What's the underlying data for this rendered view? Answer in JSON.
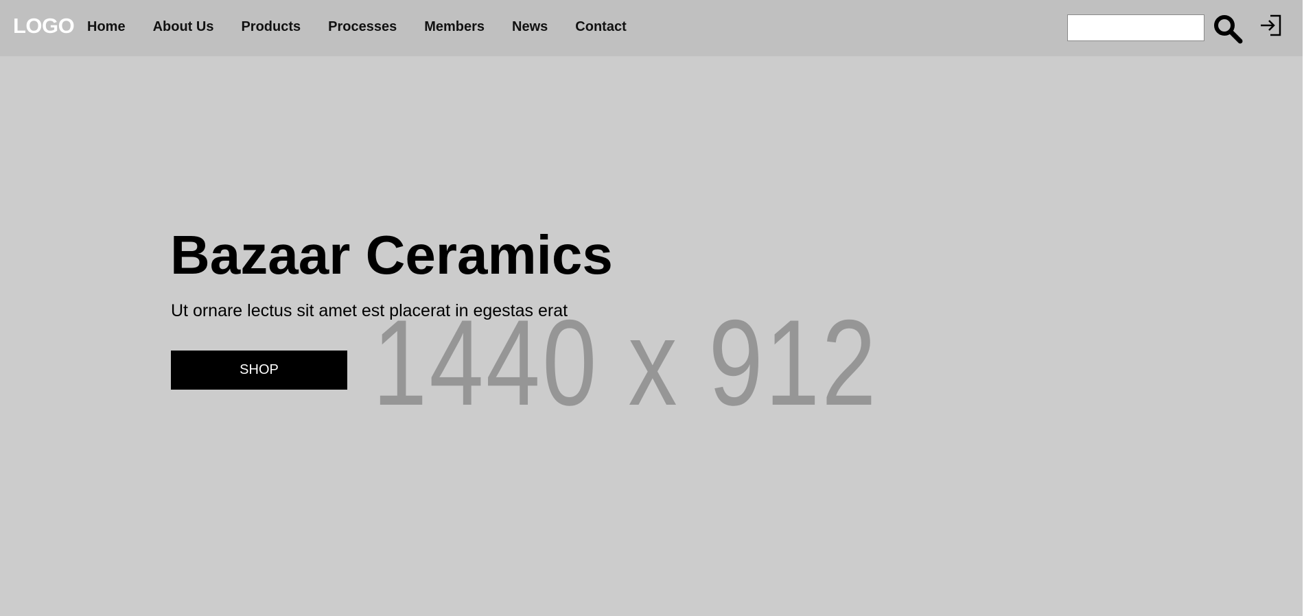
{
  "header": {
    "logo": "LOGO",
    "nav": [
      {
        "label": "Home"
      },
      {
        "label": "About Us"
      },
      {
        "label": "Products"
      },
      {
        "label": "Processes"
      },
      {
        "label": "Members"
      },
      {
        "label": "News"
      },
      {
        "label": "Contact"
      }
    ],
    "search": {
      "value": "",
      "placeholder": ""
    },
    "icons": [
      "search-icon",
      "login-icon"
    ]
  },
  "hero": {
    "placeholder_size_text": "1440 x 912",
    "title": "Bazaar Ceramics",
    "subtitle": "Ut ornare lectus sit amet est placerat in egestas erat",
    "shop_label": "SHOP"
  },
  "colors": {
    "navbar_bg": "#c0c0c0",
    "hero_bg": "#cccccc",
    "placeholder_text": "#969696",
    "button_bg": "#000000",
    "button_text": "#ffffff",
    "logo": "#ffffff"
  }
}
